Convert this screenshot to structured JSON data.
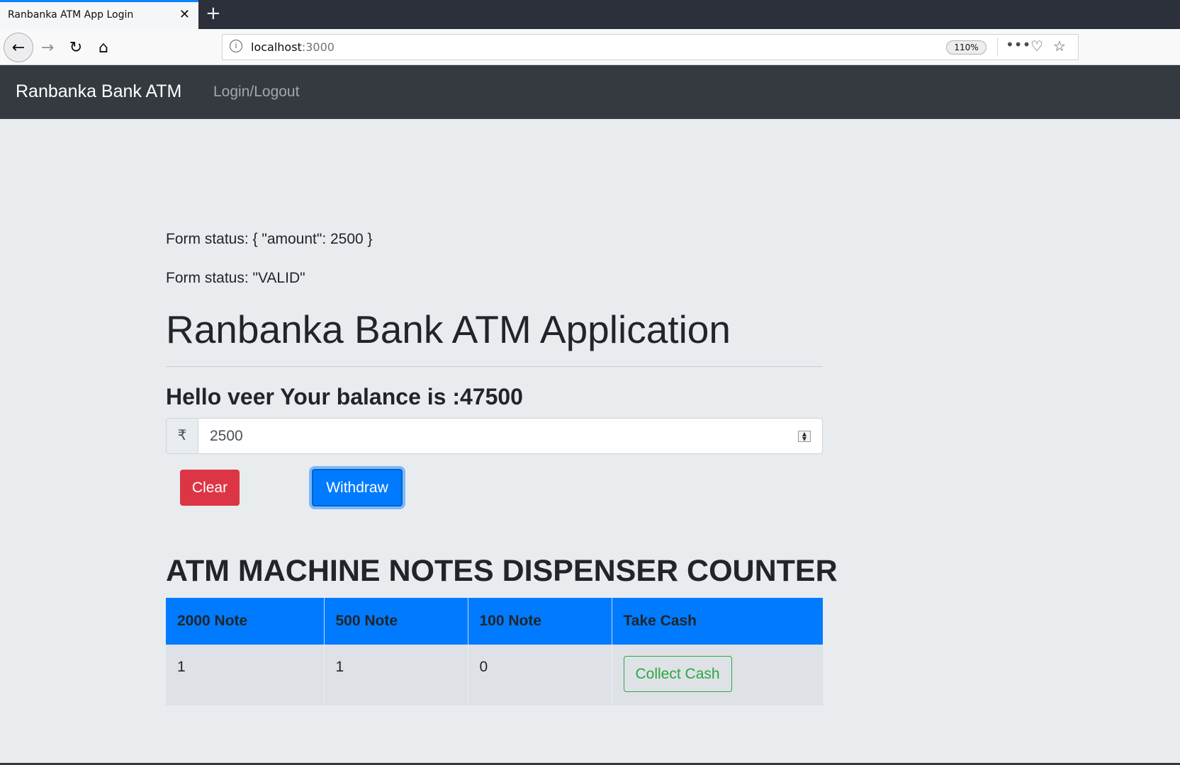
{
  "browser": {
    "tab_title": "Ranbanka ATM App Login",
    "tab_close": "✕",
    "new_tab": "+",
    "url_host": "localhost",
    "url_port": ":3000",
    "zoom": "110%"
  },
  "navbar": {
    "brand": "Ranbanka Bank ATM",
    "login_link": "Login/Logout"
  },
  "main": {
    "form_status_value": "Form status: { \"amount\": 2500 }",
    "form_status_validity": "Form status: \"VALID\"",
    "title": "Ranbanka Bank ATM Application",
    "balance_text": "Hello veer Your balance is :47500",
    "currency_symbol": "₹",
    "amount_value": "2500",
    "clear_label": "Clear",
    "withdraw_label": "Withdraw"
  },
  "counter": {
    "title": "ATM MACHINE NOTES DISPENSER COUNTER",
    "headers": [
      "2000 Note",
      "500 Note",
      "100 Note",
      "Take Cash"
    ],
    "row": [
      "1",
      "1",
      "0"
    ],
    "collect_label": "Collect Cash"
  },
  "colors": {
    "navbar_bg": "#343a40",
    "page_bg": "#e9ecef",
    "primary": "#007bff",
    "danger": "#dc3545",
    "success": "#28a745"
  }
}
